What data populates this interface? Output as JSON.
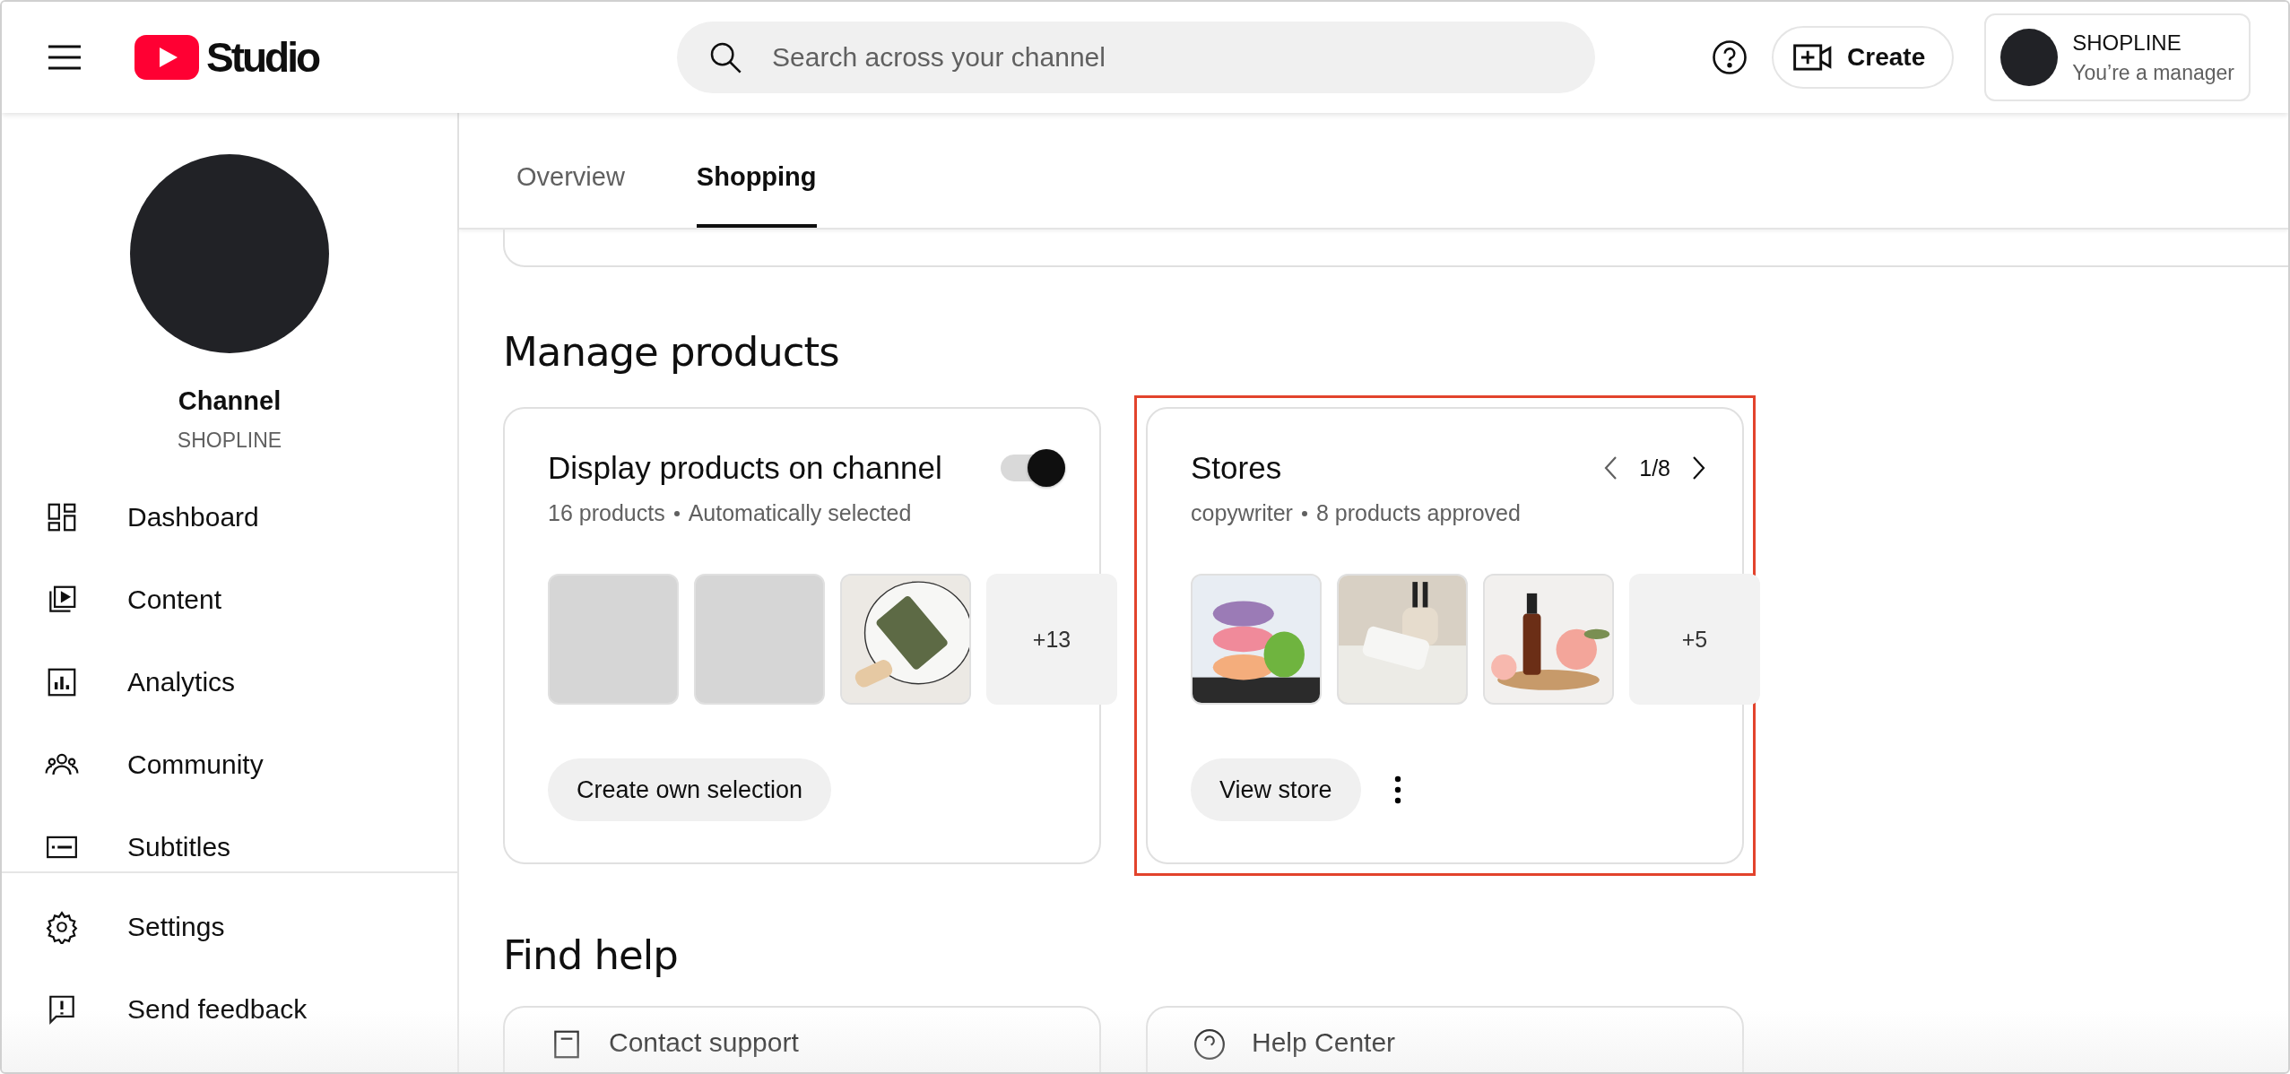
{
  "header": {
    "logo_text": "Studio",
    "search": {
      "placeholder": "Search across your channel"
    },
    "create_label": "Create",
    "account": {
      "name": "SHOPLINE",
      "role": "You’re a manager"
    }
  },
  "sidebar": {
    "channel_title": "Channel",
    "channel_name": "SHOPLINE",
    "nav_items": [
      {
        "label": "Dashboard"
      },
      {
        "label": "Content"
      },
      {
        "label": "Analytics"
      },
      {
        "label": "Community"
      },
      {
        "label": "Subtitles"
      }
    ],
    "footer_items": [
      {
        "label": "Settings"
      },
      {
        "label": "Send feedback"
      }
    ]
  },
  "tabs": [
    {
      "label": "Overview",
      "selected": false
    },
    {
      "label": "Shopping",
      "selected": true
    }
  ],
  "manage_products": {
    "title": "Manage products",
    "cards": [
      {
        "kind": "display",
        "title": "Display products on channel",
        "toggle_on": true,
        "subtitle": [
          "16 products",
          "Automatically selected"
        ],
        "thumbnails": [
          {
            "kind": "placeholder"
          },
          {
            "kind": "placeholder"
          },
          {
            "kind": "picture"
          }
        ],
        "more": "+13",
        "button": "Create own selection",
        "highlighted": false
      },
      {
        "kind": "stores",
        "title": "Stores",
        "pager": "1/8",
        "subtitle": [
          "copywriter",
          "8 products approved"
        ],
        "thumbnails": [
          {
            "kind": "picture"
          },
          {
            "kind": "picture"
          },
          {
            "kind": "picture"
          }
        ],
        "more": "+5",
        "button": "View store",
        "highlighted": true
      }
    ]
  },
  "find_help": {
    "title": "Find help",
    "cards": [
      {
        "label": "Contact support"
      },
      {
        "label": "Help Center"
      }
    ]
  }
}
